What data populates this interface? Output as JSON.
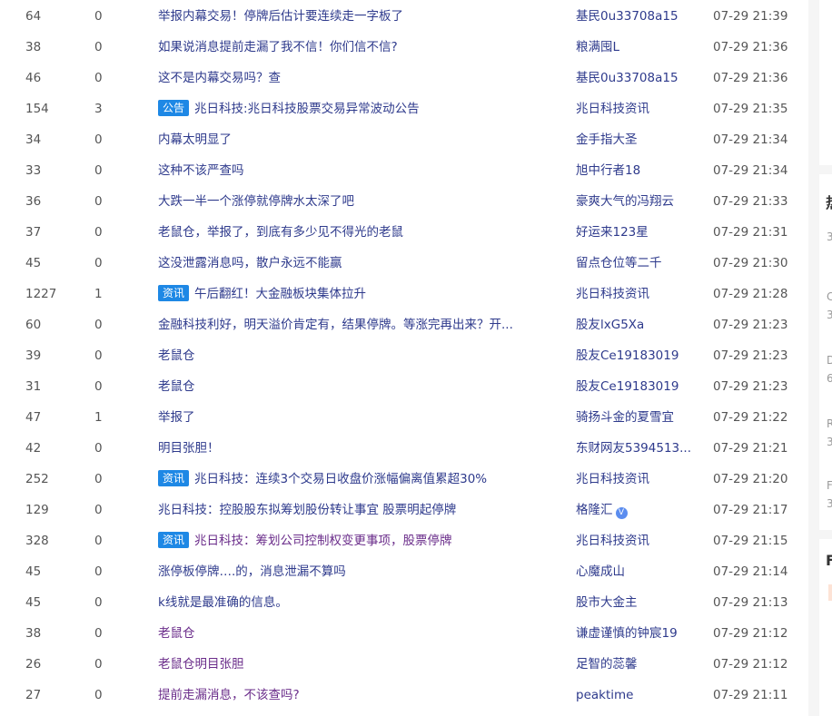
{
  "posts": [
    {
      "reads": "64",
      "comments": "0",
      "title": "举报内幕交易！停牌后估计要连续走一字板了",
      "badge": "",
      "author": "基民0u33708a15",
      "time": "07-29 21:39",
      "verified": false
    },
    {
      "reads": "38",
      "comments": "0",
      "title": "如果说消息提前走漏了我不信！你们信不信?",
      "badge": "",
      "author": "粮满囤L",
      "time": "07-29 21:36",
      "verified": false
    },
    {
      "reads": "46",
      "comments": "0",
      "title": "这不是内幕交易吗？查",
      "badge": "",
      "author": "基民0u33708a15",
      "time": "07-29 21:36",
      "verified": false
    },
    {
      "reads": "154",
      "comments": "3",
      "title": "兆日科技:兆日科技股票交易异常波动公告",
      "badge": "公告",
      "author": "兆日科技资讯",
      "time": "07-29 21:35",
      "verified": false
    },
    {
      "reads": "34",
      "comments": "0",
      "title": "内幕太明显了",
      "badge": "",
      "author": "金手指大圣",
      "time": "07-29 21:34",
      "verified": false
    },
    {
      "reads": "33",
      "comments": "0",
      "title": "这种不该严查吗",
      "badge": "",
      "author": "旭中行者18",
      "time": "07-29 21:34",
      "verified": false
    },
    {
      "reads": "36",
      "comments": "0",
      "title": "大跌一半一个涨停就停牌水太深了吧",
      "badge": "",
      "author": "豪爽大气的冯翔云",
      "time": "07-29 21:33",
      "verified": false
    },
    {
      "reads": "37",
      "comments": "0",
      "title": "老鼠仓，举报了，到底有多少见不得光的老鼠",
      "badge": "",
      "author": "好运来123星",
      "time": "07-29 21:31",
      "verified": false
    },
    {
      "reads": "45",
      "comments": "0",
      "title": "这没泄露消息吗，散户永远不能赢",
      "badge": "",
      "author": "留点仓位等二千",
      "time": "07-29 21:30",
      "verified": false
    },
    {
      "reads": "1227",
      "comments": "1",
      "title": "午后翻红！大金融板块集体拉升",
      "badge": "资讯",
      "author": "兆日科技资讯",
      "time": "07-29 21:28",
      "verified": false
    },
    {
      "reads": "60",
      "comments": "0",
      "title": "金融科技利好，明天溢价肯定有，结果停牌。等涨完再出来？开...",
      "badge": "",
      "author": "股友lxG5Xa",
      "time": "07-29 21:23",
      "verified": false
    },
    {
      "reads": "39",
      "comments": "0",
      "title": "老鼠仓",
      "badge": "",
      "author": "股友Ce19183019",
      "time": "07-29 21:23",
      "verified": false
    },
    {
      "reads": "31",
      "comments": "0",
      "title": "老鼠仓",
      "badge": "",
      "author": "股友Ce19183019",
      "time": "07-29 21:23",
      "verified": false
    },
    {
      "reads": "47",
      "comments": "1",
      "title": "举报了",
      "badge": "",
      "author": "骑扬斗金的夏雪宜",
      "time": "07-29 21:22",
      "verified": false
    },
    {
      "reads": "42",
      "comments": "0",
      "title": "明目张胆！",
      "badge": "",
      "author": "东财网友5394513...",
      "time": "07-29 21:21",
      "verified": false
    },
    {
      "reads": "252",
      "comments": "0",
      "title": "兆日科技：连续3个交易日收盘价涨幅偏离值累超30%",
      "badge": "资讯",
      "author": "兆日科技资讯",
      "time": "07-29 21:20",
      "verified": false
    },
    {
      "reads": "129",
      "comments": "0",
      "title": "兆日科技：控股股东拟筹划股份转让事宜 股票明起停牌",
      "badge": "",
      "author": "格隆汇",
      "time": "07-29 21:17",
      "verified": true
    },
    {
      "reads": "328",
      "comments": "0",
      "title": "兆日科技：筹划公司控制权变更事项，股票停牌",
      "badge": "资讯",
      "author": "兆日科技资讯",
      "time": "07-29 21:15",
      "verified": false
    },
    {
      "reads": "45",
      "comments": "0",
      "title": "涨停板停牌….的，消息泄漏不算吗",
      "badge": "",
      "author": "心魔成山",
      "time": "07-29 21:14",
      "verified": false
    },
    {
      "reads": "45",
      "comments": "0",
      "title": "k线就是最准确的信息。",
      "badge": "",
      "author": "股市大金主",
      "time": "07-29 21:13",
      "verified": false
    },
    {
      "reads": "38",
      "comments": "0",
      "title": "老鼠仓",
      "badge": "",
      "author": "谦虚谨慎的钟宸19",
      "time": "07-29 21:12",
      "verified": false
    },
    {
      "reads": "26",
      "comments": "0",
      "title": "老鼠仓明目张胆",
      "badge": "",
      "author": "足智的蕊馨",
      "time": "07-29 21:12",
      "verified": false
    },
    {
      "reads": "27",
      "comments": "0",
      "title": "提前走漏消息，不该查吗?",
      "badge": "",
      "author": "peaktime",
      "time": "07-29 21:11",
      "verified": false
    }
  ],
  "verified_mark": "V",
  "right_panel": {
    "heading": "热",
    "fragments": [
      "3",
      "C",
      "3",
      "D",
      "6",
      "R",
      "3",
      "F",
      "3"
    ],
    "heading2": "F"
  },
  "colors": {
    "badge": "#1e88e5",
    "link": "#2e3a8c",
    "visited": "#6a2c8a"
  }
}
